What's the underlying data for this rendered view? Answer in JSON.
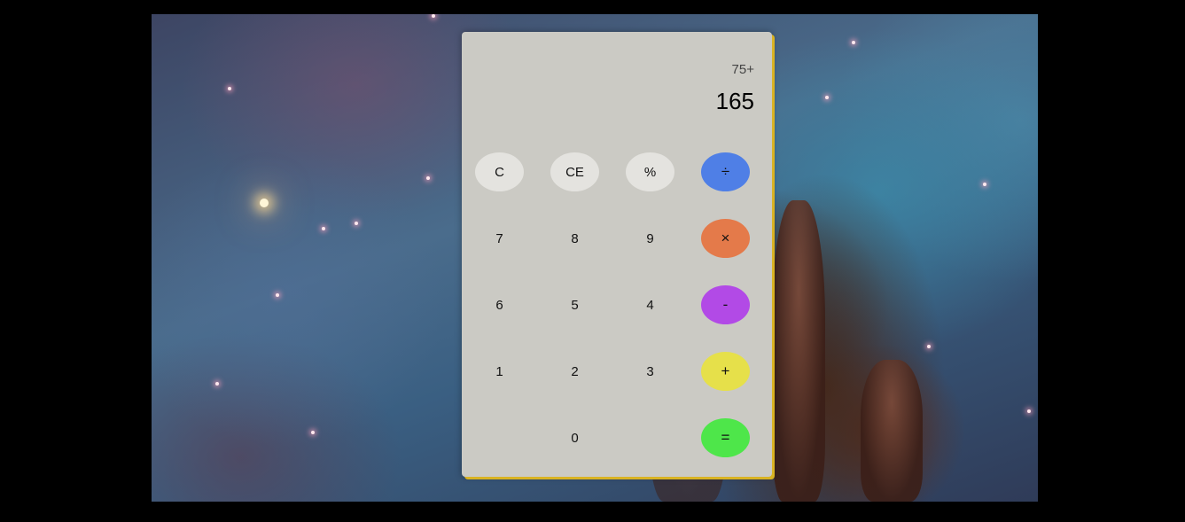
{
  "display": {
    "expression": "75+",
    "result": "165"
  },
  "buttons": [
    {
      "id": "clear-button",
      "label": "C",
      "style": "light",
      "color": "#e4e3df"
    },
    {
      "id": "clear-entry-button",
      "label": "CE",
      "style": "light",
      "color": "#e4e3df"
    },
    {
      "id": "percent-button",
      "label": "%",
      "style": "light",
      "color": "#e4e3df"
    },
    {
      "id": "divide-button",
      "label": "÷",
      "style": "op",
      "color": "#4f7fe6"
    },
    {
      "id": "digit-7-button",
      "label": "7",
      "style": "plain"
    },
    {
      "id": "digit-8-button",
      "label": "8",
      "style": "plain"
    },
    {
      "id": "digit-9-button",
      "label": "9",
      "style": "plain"
    },
    {
      "id": "multiply-button",
      "label": "×",
      "style": "op",
      "color": "#e47a4a"
    },
    {
      "id": "digit-6-button",
      "label": "6",
      "style": "plain"
    },
    {
      "id": "digit-5-button",
      "label": "5",
      "style": "plain"
    },
    {
      "id": "digit-4-button",
      "label": "4",
      "style": "plain"
    },
    {
      "id": "subtract-button",
      "label": "-",
      "style": "op",
      "color": "#b24ae6"
    },
    {
      "id": "digit-1-button",
      "label": "1",
      "style": "plain"
    },
    {
      "id": "digit-2-button",
      "label": "2",
      "style": "plain"
    },
    {
      "id": "digit-3-button",
      "label": "3",
      "style": "plain"
    },
    {
      "id": "add-button",
      "label": "+",
      "style": "op",
      "color": "#e6e04a"
    },
    {
      "id": "digit-0-button",
      "label": "0",
      "style": "plain"
    },
    {
      "id": "equals-button",
      "label": "=",
      "style": "op",
      "color": "#4ee64a"
    }
  ],
  "colors": {
    "panel": "#cbcac4",
    "panel_shadow": "#d9b323",
    "page_background": "#000000"
  }
}
